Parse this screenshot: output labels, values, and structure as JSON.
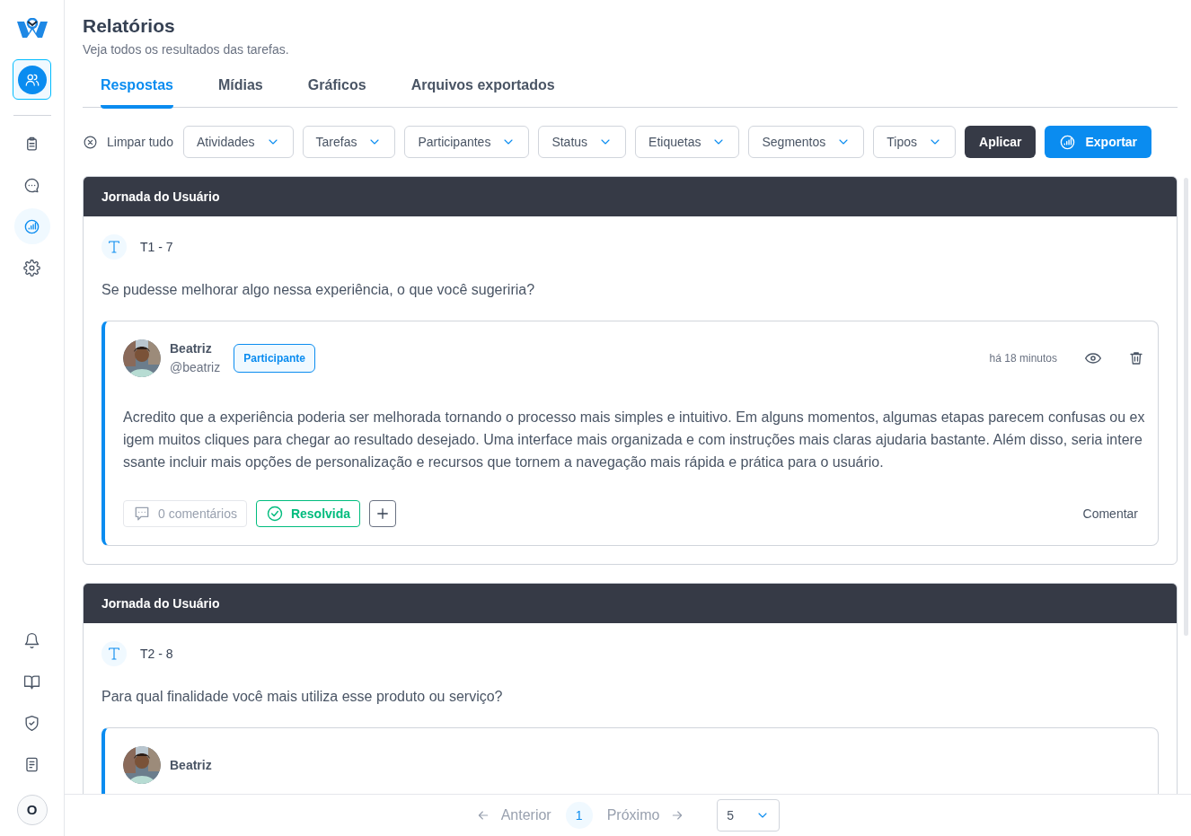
{
  "sidebar": {
    "items": [
      {
        "kind": "clipboard",
        "selected": false
      },
      {
        "kind": "chat",
        "selected": false
      },
      {
        "kind": "chart",
        "selected": true
      },
      {
        "kind": "gear",
        "selected": false
      }
    ],
    "bottom_items": [
      {
        "kind": "bell"
      },
      {
        "kind": "book"
      },
      {
        "kind": "shield"
      },
      {
        "kind": "doc"
      }
    ],
    "avatar": "O"
  },
  "page": {
    "title": "Relatórios",
    "subtitle": "Veja todos os resultados das tarefas."
  },
  "tabs": [
    {
      "label": "Respostas",
      "selected": true
    },
    {
      "label": "Mídias",
      "selected": false
    },
    {
      "label": "Gráficos",
      "selected": false
    },
    {
      "label": "Arquivos exportados",
      "selected": false
    }
  ],
  "filters": {
    "clear": "Limpar tudo",
    "dropdowns": [
      "Atividades",
      "Tarefas",
      "Participantes",
      "Status",
      "Etiquetas",
      "Segmentos",
      "Tipos"
    ],
    "apply": "Aplicar",
    "export": "Exportar"
  },
  "cards": [
    {
      "header": "Jornada do Usuário",
      "task": "T1 - 7",
      "question": "Se pudesse melhorar algo nessa experiência, o que você sugeriria?",
      "response": {
        "author": "Beatriz",
        "handle": "@beatriz",
        "badge": "Participante",
        "time": "há 18 minutos",
        "text": "Acredito que a experiência poderia ser melhorada tornando o processo mais simples e intuitivo. Em alguns momentos, algumas etapas parecem confusas ou exigem muitos cliques para chegar ao resultado desejado. Uma interface mais organizada e com instruções mais claras ajudaria bastante. Além disso, seria interessante incluir mais opções de personalização e recursos que tornem a navegação mais rápida e prática para o usuário.",
        "comments": "0 comentários",
        "status": "Resolvida",
        "resolved": true,
        "comment_action": "Comentar"
      }
    },
    {
      "header": "Jornada do Usuário",
      "task": "T2 - 8",
      "question": "Para qual finalidade você mais utiliza esse produto ou serviço?",
      "response": {
        "author": "Beatriz"
      }
    }
  ],
  "pagination": {
    "previous": "Anterior",
    "pages": [
      {
        "label": "1",
        "selected": true
      }
    ],
    "next": "Próximo",
    "page_size": "5"
  }
}
